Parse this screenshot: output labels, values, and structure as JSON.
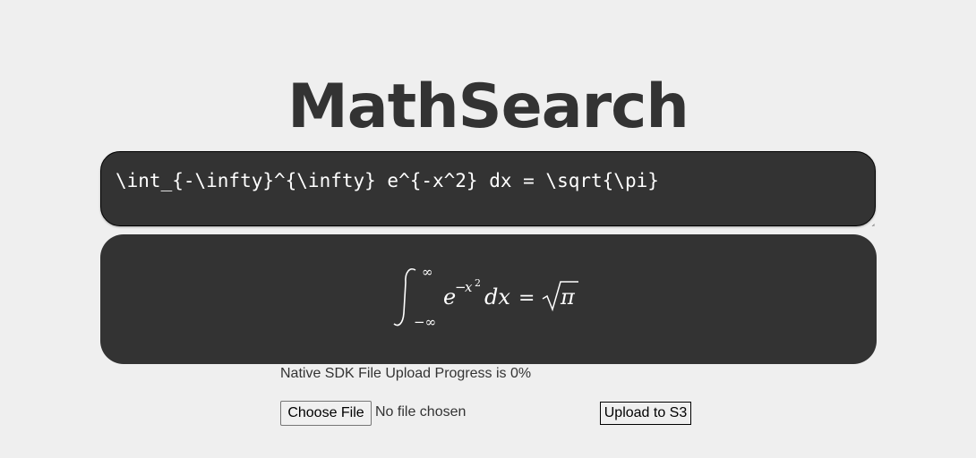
{
  "app_title": "MathSearch",
  "latex_input": {
    "value": "\\int_{-\\infty}^{\\infty} e^{-x^2} dx = \\sqrt{\\pi}"
  },
  "rendered_formula": {
    "int_lower": "−∞",
    "int_upper": "∞",
    "base": "e",
    "exp_sign": "−",
    "exp_var": "x",
    "exp_power": "2",
    "dx": "dx",
    "equals": "=",
    "sqrt_arg": "π"
  },
  "upload": {
    "progress_text": "Native SDK File Upload Progress is 0%",
    "progress_percent": 0,
    "choose_file_label": "Choose File",
    "file_status": "No file chosen",
    "upload_button_label": "Upload to S3"
  },
  "colors": {
    "background": "#efefef",
    "panel": "#333333",
    "title": "#333333",
    "panel_text": "#ffffff"
  }
}
